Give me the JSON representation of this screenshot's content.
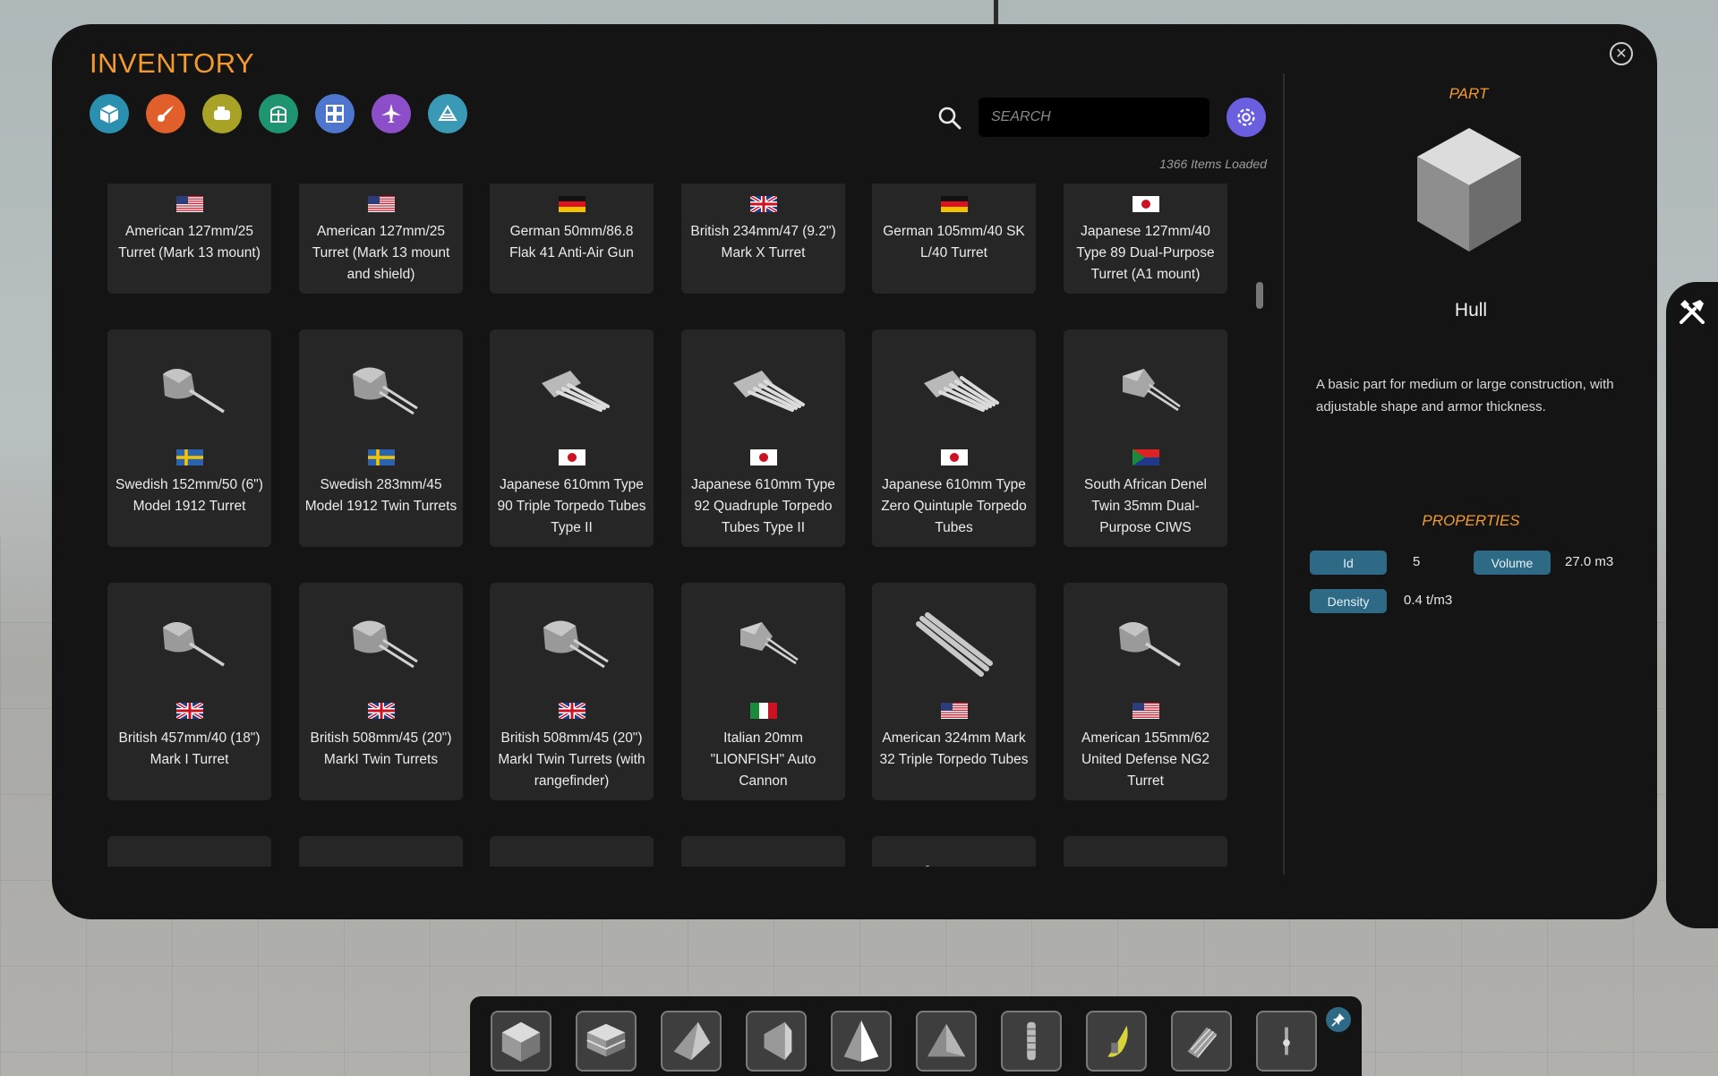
{
  "inventory": {
    "title": "INVENTORY",
    "categories": [
      {
        "icon": "cube-icon",
        "color": "#2b8fb0"
      },
      {
        "icon": "weapons-icon",
        "color": "#e05f2a"
      },
      {
        "icon": "engine-icon",
        "color": "#a8a326"
      },
      {
        "icon": "structure-icon",
        "color": "#1f9470"
      },
      {
        "icon": "grid-icon",
        "color": "#4f76cf"
      },
      {
        "icon": "aircraft-icon",
        "color": "#8d4fc9"
      },
      {
        "icon": "deck-icon",
        "color": "#3a9ab5"
      }
    ],
    "search_placeholder": "SEARCH",
    "items_loaded": "1366 Items Loaded",
    "items": [
      {
        "name": "American 127mm/25 Turret (Mark 13 mount)",
        "flag": "us",
        "thumb": "turret-single"
      },
      {
        "name": "American 127mm/25 Turret (Mark 13 mount and shield)",
        "flag": "us",
        "thumb": "turret-single"
      },
      {
        "name": "German 50mm/86.8 Flak 41 Anti-Air Gun",
        "flag": "de",
        "thumb": "turret-single"
      },
      {
        "name": "British 234mm/47 (9.2\") Mark X Turret",
        "flag": "uk",
        "thumb": "turret-single"
      },
      {
        "name": "German 105mm/40 SK L/40 Turret",
        "flag": "de",
        "thumb": "turret-single"
      },
      {
        "name": "Japanese 127mm/40 Type 89 Dual-Purpose Turret (A1 mount)",
        "flag": "jp",
        "thumb": "turret-twin"
      },
      {
        "name": "Swedish 152mm/50 (6\") Model 1912 Turret",
        "flag": "se",
        "thumb": "turret-single"
      },
      {
        "name": "Swedish 283mm/45 Model 1912 Twin Turrets",
        "flag": "se",
        "thumb": "turret-twin"
      },
      {
        "name": "Japanese 610mm Type 90 Triple Torpedo Tubes Type II",
        "flag": "jp",
        "thumb": "torpedo-3"
      },
      {
        "name": "Japanese 610mm Type 92 Quadruple Torpedo Tubes Type II",
        "flag": "jp",
        "thumb": "torpedo-4"
      },
      {
        "name": "Japanese 610mm Type Zero Quintuple Torpedo Tubes",
        "flag": "jp",
        "thumb": "torpedo-5"
      },
      {
        "name": "South African Denel Twin 35mm Dual-Purpose CIWS",
        "flag": "za",
        "thumb": "ciws"
      },
      {
        "name": "British 457mm/40 (18\") Mark I Turret",
        "flag": "uk",
        "thumb": "turret-single"
      },
      {
        "name": "British 508mm/45 (20\") MarkI Twin Turrets",
        "flag": "uk",
        "thumb": "turret-twin"
      },
      {
        "name": "British 508mm/45 (20\") MarkI Twin Turrets (with rangefinder)",
        "flag": "uk",
        "thumb": "turret-twin"
      },
      {
        "name": "Italian 20mm \"LIONFISH\" Auto Cannon",
        "flag": "it",
        "thumb": "ciws"
      },
      {
        "name": "American 324mm Mark 32 Triple Torpedo Tubes",
        "flag": "us",
        "thumb": "torpedo-long"
      },
      {
        "name": "American 155mm/62 United Defense NG2 Turret",
        "flag": "us",
        "thumb": "turret-single"
      },
      {
        "name": "",
        "flag": "",
        "thumb": "turret-single"
      },
      {
        "name": "",
        "flag": "",
        "thumb": "turret-single"
      },
      {
        "name": "",
        "flag": "",
        "thumb": "turret-single"
      },
      {
        "name": "",
        "flag": "",
        "thumb": "ciws"
      },
      {
        "name": "",
        "flag": "",
        "thumb": "torpedo-long"
      },
      {
        "name": "",
        "flag": "",
        "thumb": "turret-single"
      }
    ]
  },
  "part": {
    "heading": "PART",
    "name": "Hull",
    "description": "A basic part for medium or large construction, with adjustable shape and armor thickness.",
    "properties_heading": "PROPERTIES",
    "properties": [
      {
        "label": "Id",
        "value": "5"
      },
      {
        "label": "Volume",
        "value": "27.0 m3"
      },
      {
        "label": "Density",
        "value": "0.4 t/m3"
      }
    ]
  },
  "hotbar": {
    "slots": [
      "cube-block-icon",
      "layered-block-icon",
      "wedge-block-icon",
      "half-wedge-icon",
      "pyramid-block-icon",
      "triangle-prism-icon",
      "cylinder-spring-icon",
      "banana-cannon-icon",
      "stairs-block-icon",
      "small-fitting-icon"
    ]
  },
  "colors": {
    "accent_orange": "#f39a2e",
    "panel_bg": "#141414",
    "card_bg": "#262626",
    "chip_blue": "#2e6a86",
    "settings_purple": "#6b5fe0"
  }
}
